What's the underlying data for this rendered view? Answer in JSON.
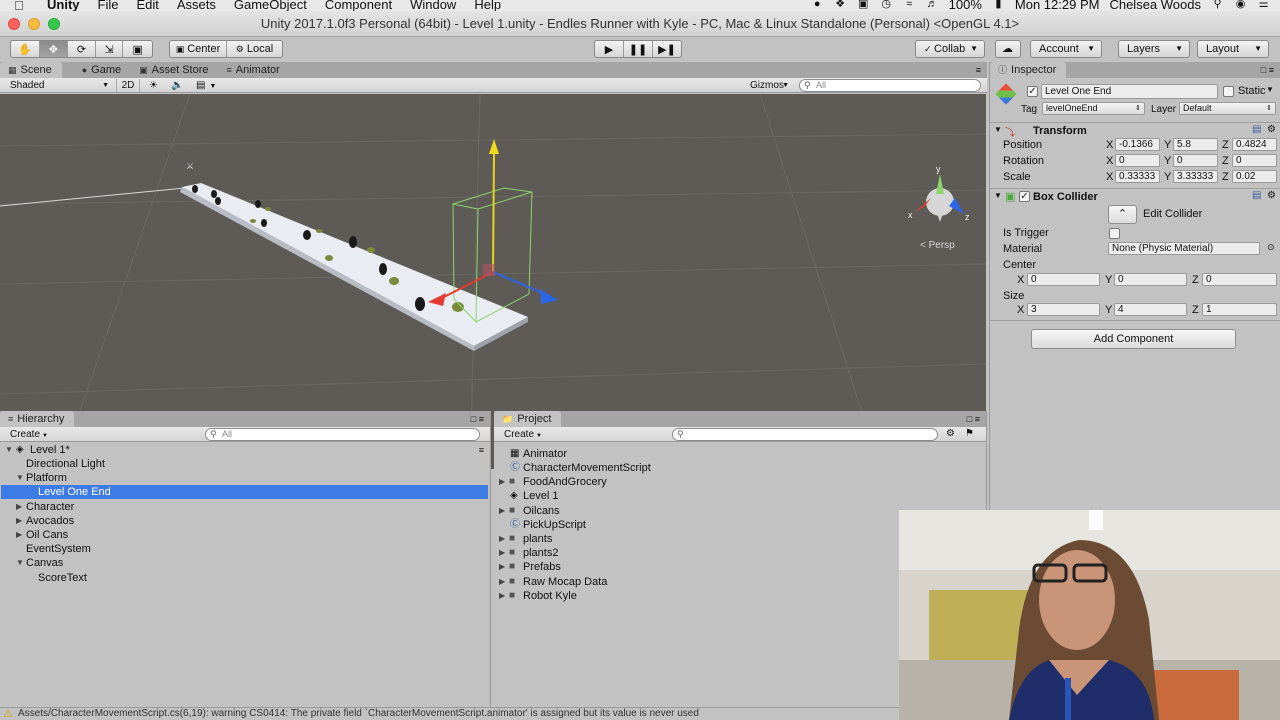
{
  "menubar": {
    "app": "Unity",
    "items": [
      "File",
      "Edit",
      "Assets",
      "GameObject",
      "Component",
      "Window",
      "Help"
    ],
    "battery": "100%",
    "clock": "Mon 12:29 PM",
    "user": "Chelsea Woods"
  },
  "window": {
    "title": "Unity 2017.1.0f3 Personal (64bit) - Level 1.unity - Endles Runner with Kyle - PC, Mac & Linux Standalone (Personal) <OpenGL 4.1>"
  },
  "toolbar": {
    "pivot": "Center",
    "space": "Local",
    "collab": "Collab",
    "account": "Account",
    "layers": "Layers",
    "layout": "Layout"
  },
  "scene_panel": {
    "tabs": [
      "Scene",
      "Game",
      "Asset Store",
      "Animator"
    ],
    "shading": "Shaded",
    "mode_2d": "2D",
    "gizmos": "Gizmos",
    "search_placeholder": "All",
    "persp_label": "< Persp",
    "axis_x": "x",
    "axis_y": "y",
    "axis_z": "z"
  },
  "inspector": {
    "tab": "Inspector",
    "object_name": "Level One End",
    "static_label": "Static",
    "tag_label": "Tag",
    "tag_value": "levelOneEnd",
    "layer_label": "Layer",
    "layer_value": "Default",
    "transform": {
      "title": "Transform",
      "position_label": "Position",
      "rotation_label": "Rotation",
      "scale_label": "Scale",
      "position": {
        "x": "-0.1366",
        "y": "5.8",
        "z": "0.4824"
      },
      "rotation": {
        "x": "0",
        "y": "0",
        "z": "0"
      },
      "scale": {
        "x": "0.33333",
        "y": "3.33333",
        "z": "0.02"
      }
    },
    "box_collider": {
      "title": "Box Collider",
      "edit_collider": "Edit Collider",
      "is_trigger_label": "Is Trigger",
      "material_label": "Material",
      "material_value": "None (Physic Material)",
      "center_label": "Center",
      "size_label": "Size",
      "center": {
        "x": "0",
        "y": "0",
        "z": "0"
      },
      "size": {
        "x": "3",
        "y": "4",
        "z": "1"
      }
    },
    "add_component": "Add Component",
    "axis_labels": {
      "x": "X",
      "y": "Y",
      "z": "Z"
    }
  },
  "hierarchy": {
    "tab": "Hierarchy",
    "create": "Create",
    "search_placeholder": "All",
    "scene": "Level 1*",
    "items": [
      {
        "label": "Directional Light"
      },
      {
        "label": "Platform"
      },
      {
        "label": "Level One End"
      },
      {
        "label": "Character"
      },
      {
        "label": "Avocados"
      },
      {
        "label": "Oil Cans"
      },
      {
        "label": "EventSystem"
      },
      {
        "label": "Canvas"
      },
      {
        "label": "ScoreText"
      }
    ]
  },
  "project": {
    "tab": "Project",
    "create": "Create",
    "items": [
      {
        "label": "Animator"
      },
      {
        "label": "CharacterMovementScript"
      },
      {
        "label": "FoodAndGrocery"
      },
      {
        "label": "Level 1"
      },
      {
        "label": "Oilcans"
      },
      {
        "label": "PickUpScript"
      },
      {
        "label": "plants"
      },
      {
        "label": "plants2"
      },
      {
        "label": "Prefabs"
      },
      {
        "label": "Raw Mocap Data"
      },
      {
        "label": "Robot Kyle"
      }
    ]
  },
  "status": {
    "message": "Assets/CharacterMovementScript.cs(6,19): warning CS0414: The private field `CharacterMovementScript.animator' is assigned but its value is never used"
  },
  "icons": {
    "apple": "apple-icon",
    "play": "play-icon",
    "pause": "pause-icon",
    "step": "step-icon",
    "cloud": "cloud-icon",
    "folder": "folder-icon",
    "script": "script-icon",
    "scene": "unity-scene-icon",
    "warning": "warning-icon"
  },
  "colors": {
    "selection": "#3d7be6",
    "scene_bg": "#5e5a56",
    "panel_bg": "#c2c2c2",
    "warning": "#d9a400"
  }
}
